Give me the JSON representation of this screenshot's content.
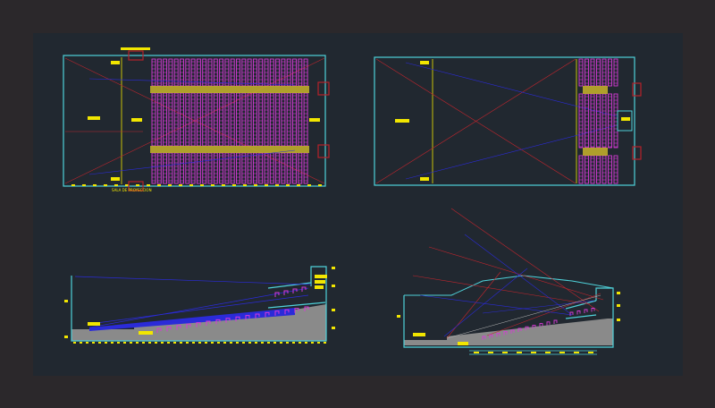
{
  "colors": {
    "outer_frame": "#2b282b",
    "modelspace_bg": "#212830",
    "wall": "#4fd1d9",
    "dimension": "#f2e600",
    "seat": "#d63ad6",
    "sight_line_blue": "#2b2bd8",
    "sight_line_red": "#c0262e",
    "section_fill": "#8a8a8a",
    "door": "#b5212a"
  },
  "drawings": [
    {
      "view": "plan",
      "side": "left",
      "text": {
        "room_label": "SALA DE PROYECCION"
      }
    },
    {
      "view": "plan",
      "side": "right"
    },
    {
      "view": "section",
      "side": "left"
    },
    {
      "view": "section",
      "side": "right"
    }
  ]
}
